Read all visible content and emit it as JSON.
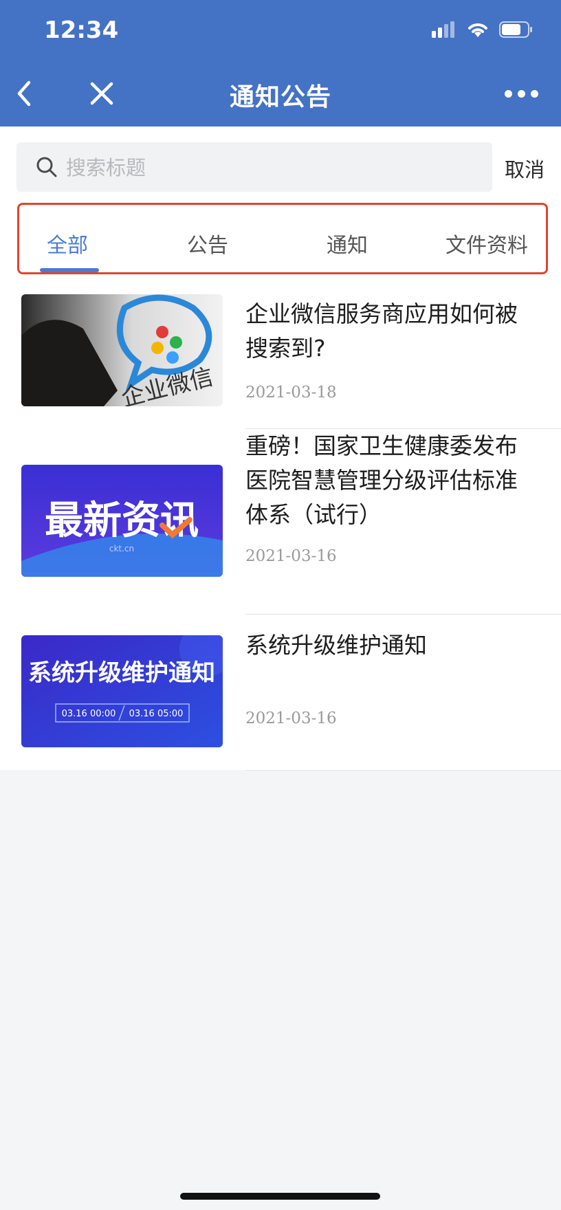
{
  "status": {
    "time": "12:34"
  },
  "nav": {
    "title": "通知公告",
    "back_icon": "chevron-left-icon",
    "close_icon": "close-icon",
    "more_icon": "more-dots-icon"
  },
  "search": {
    "placeholder": "搜索标题",
    "value": "",
    "cancel_label": "取消"
  },
  "tabs": [
    {
      "label": "全部",
      "active": true
    },
    {
      "label": "公告",
      "active": false
    },
    {
      "label": "通知",
      "active": false
    },
    {
      "label": "文件资料",
      "active": false
    }
  ],
  "items": [
    {
      "title": "企业微信服务商应用如何被搜索到?",
      "date": "2021-03-18",
      "thumb_text": "企业微信"
    },
    {
      "title": "重磅！国家卫生健康委发布医院智慧管理分级评估标准体系（试行）",
      "date": "2021-03-16",
      "thumb_text": "最新资讯",
      "thumb_sub": "ckt.cn"
    },
    {
      "title": "系统升级维护通知",
      "date": "2021-03-16",
      "thumb_text": "系统升级维护通知",
      "thumb_time_start": "03.16 00:00",
      "thumb_time_end": "03.16 05:00"
    }
  ],
  "colors": {
    "brand": "#4472c4",
    "active_tab": "#4a7bd0",
    "highlight": "#e2432e"
  }
}
